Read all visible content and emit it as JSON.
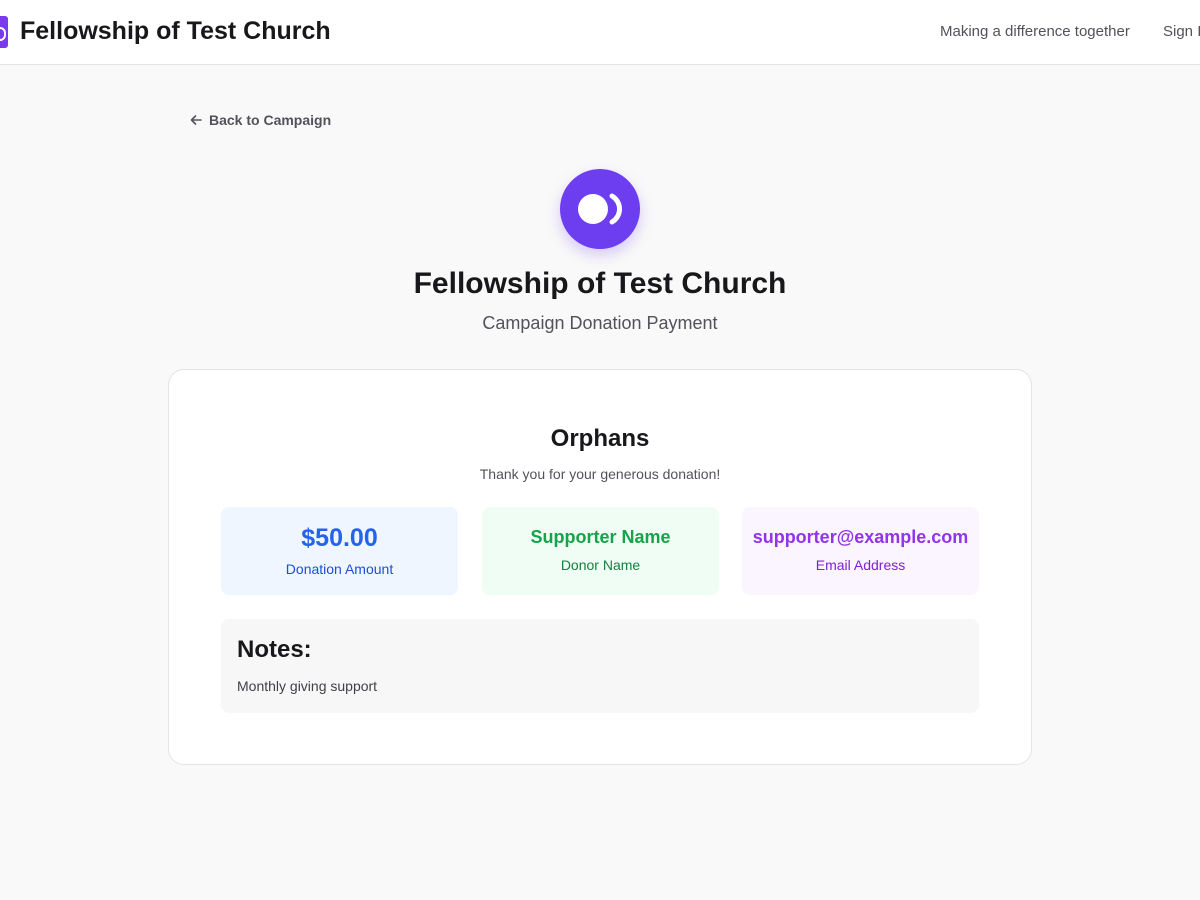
{
  "header": {
    "brand_name": "Fellowship of Test Church",
    "tagline": "Making a difference together",
    "signin_label": "Sign In"
  },
  "back_link": {
    "label": "Back to Campaign",
    "icon": "arrow-left-icon"
  },
  "organization": {
    "logo_icon": "org-logo-icon",
    "name": "Fellowship of Test Church",
    "subtitle": "Campaign Donation Payment"
  },
  "donation": {
    "campaign_name": "Orphans",
    "thank_you": "Thank you for your generous donation!",
    "amount": {
      "value": "$50.00",
      "label": "Donation Amount"
    },
    "donor": {
      "value": "Supporter Name",
      "label": "Donor Name"
    },
    "email": {
      "value": "supporter@example.com",
      "label": "Email Address"
    },
    "notes": {
      "title": "Notes:",
      "text": "Monthly giving support"
    }
  },
  "colors": {
    "brand": "#6d3df0",
    "amount": "#2563eb",
    "donor": "#16a34a",
    "email": "#9333ea"
  }
}
